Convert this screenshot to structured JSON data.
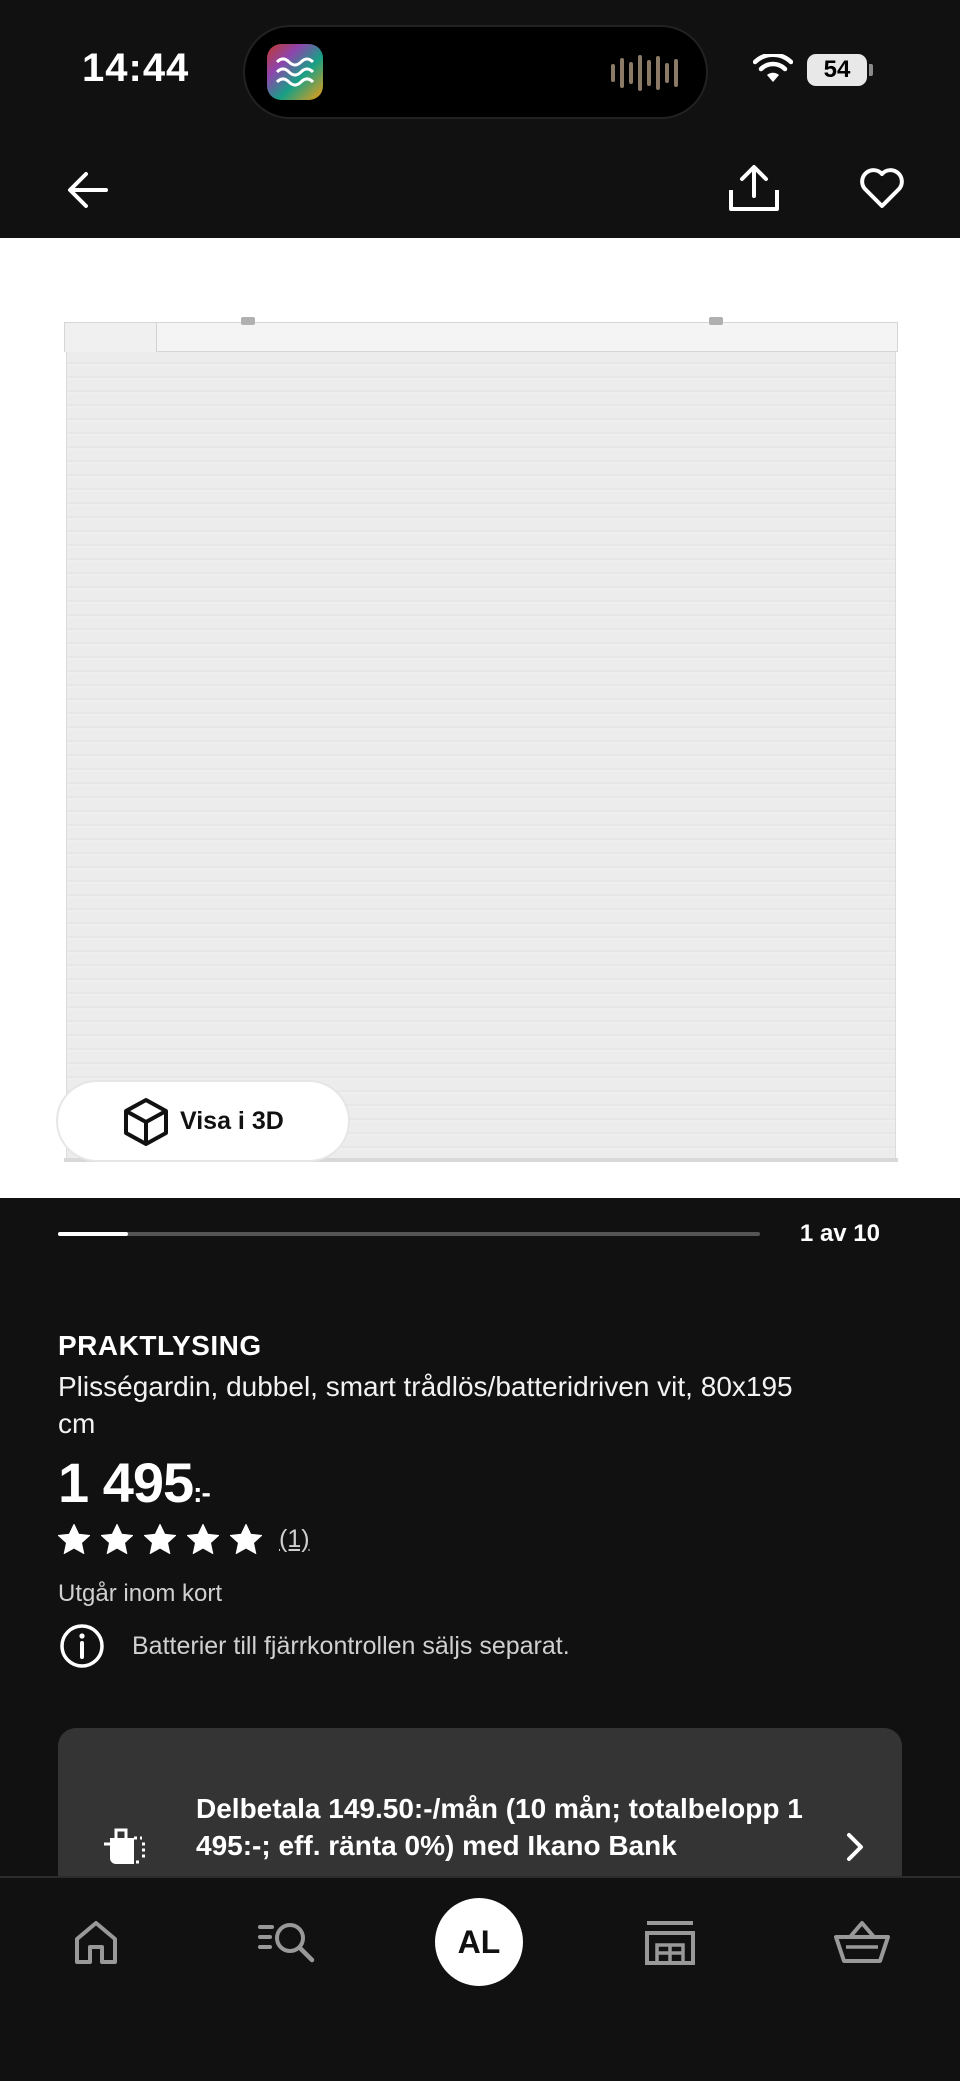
{
  "status_bar": {
    "time": "14:44",
    "battery": "54",
    "icons": [
      "wifi-icon",
      "battery-icon",
      "sound-wave-icon"
    ]
  },
  "top_bar": {
    "icons": [
      "arrow-left-icon",
      "share-icon",
      "heart-icon"
    ]
  },
  "media": {
    "view_3d_label": "Visa i 3D",
    "counter": "1 av 10",
    "progress": 0.1
  },
  "product": {
    "name": "PRAKTLYSING",
    "description": "Plisségardin, dubbel, smart trådlös/batteridriven vit, 80x195 cm",
    "price": "1 495",
    "price_suffix": ":-",
    "rating": 5,
    "rating_max": 5,
    "review_count": "(1)",
    "availability": "Utgår inom kort",
    "notice": "Batterier till fjärrkontrollen säljs separat."
  },
  "payment": {
    "text": "Delbetala 149.50:-/mån (10 mån; totalbelopp 1 495:-; eff. ränta 0%) med Ikano Bank"
  },
  "bottom_nav": {
    "avatar_initials": "AL",
    "items": [
      "home-icon",
      "search-list-icon",
      "avatar",
      "store-icon",
      "basket-icon"
    ]
  },
  "colors": {
    "background": "#111111",
    "card": "#343434",
    "text": "#ffffff",
    "muted": "#d0d0d0"
  }
}
